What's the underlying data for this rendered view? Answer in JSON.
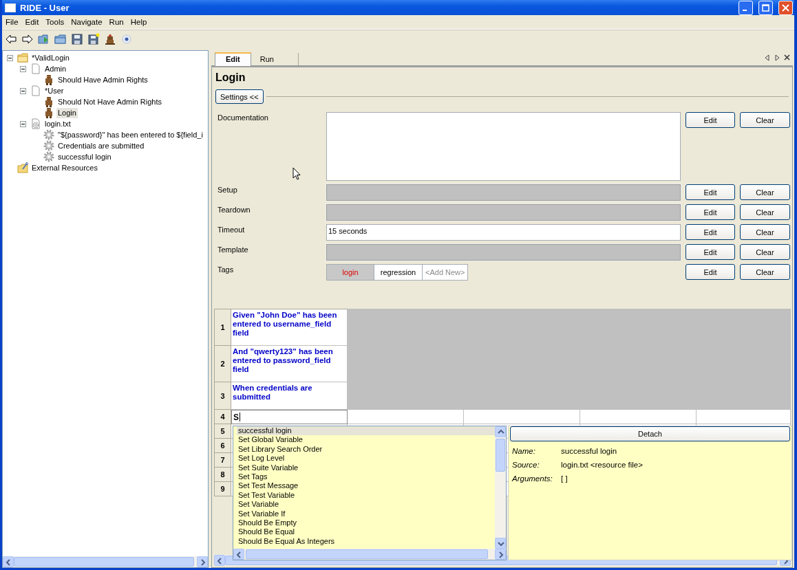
{
  "window": {
    "title": "RIDE - User"
  },
  "menu": [
    "File",
    "Edit",
    "Tools",
    "Navigate",
    "Run",
    "Help"
  ],
  "tree": [
    {
      "label": "*ValidLogin",
      "kind": "suite",
      "expanded": true,
      "selected": false,
      "children": [
        {
          "label": "Admin",
          "kind": "file",
          "expanded": true,
          "selected": false,
          "children": [
            {
              "label": "Should Have Admin Rights",
              "kind": "test",
              "selected": false
            }
          ]
        },
        {
          "label": "*User",
          "kind": "file",
          "expanded": true,
          "selected": false,
          "children": [
            {
              "label": "Should Not Have Admin Rights",
              "kind": "test",
              "selected": false
            },
            {
              "label": "Login",
              "kind": "test",
              "selected": true
            }
          ]
        },
        {
          "label": "login.txt",
          "kind": "resource",
          "expanded": true,
          "selected": false,
          "children": [
            {
              "label": "\"${password}\" has been entered to ${field_i",
              "kind": "keyword",
              "selected": false
            },
            {
              "label": "Credentials are submitted",
              "kind": "keyword",
              "selected": false
            },
            {
              "label": "successful login",
              "kind": "keyword",
              "selected": false
            }
          ]
        }
      ]
    },
    {
      "label": "External Resources",
      "kind": "external",
      "selected": false
    }
  ],
  "tabs": [
    {
      "label": "Edit",
      "selected": true
    },
    {
      "label": "Run",
      "selected": false
    }
  ],
  "editor": {
    "title": "Login",
    "settings_button": "Settings <<",
    "settings": [
      {
        "label": "Documentation",
        "kind": "multiline",
        "disabled": false,
        "edit_button": "Edit",
        "clear_button": "Clear"
      },
      {
        "label": "Setup",
        "kind": "line",
        "disabled": true,
        "edit_button": "Edit",
        "clear_button": "Clear"
      },
      {
        "label": "Teardown",
        "kind": "line",
        "disabled": true,
        "edit_button": "Edit",
        "clear_button": "Clear"
      },
      {
        "label": "Timeout",
        "kind": "line",
        "disabled": false,
        "value": "15 seconds",
        "edit_button": "Edit",
        "clear_button": "Clear"
      },
      {
        "label": "Template",
        "kind": "line",
        "disabled": true,
        "edit_button": "Edit",
        "clear_button": "Clear"
      },
      {
        "label": "Tags",
        "kind": "tags",
        "tags": [
          {
            "label": "login",
            "kind": "forced"
          },
          {
            "label": "regression",
            "kind": "normal"
          },
          {
            "label": "<Add New>",
            "kind": "add"
          }
        ],
        "edit_button": "Edit",
        "clear_button": "Clear"
      }
    ]
  },
  "grid": {
    "rows": [
      {
        "number": "1",
        "kind": "keyword",
        "text": "Given \"John Doe\" has been entered to username_field field"
      },
      {
        "number": "2",
        "kind": "keyword",
        "text": "And \"qwerty123\" has been entered to password_field field"
      },
      {
        "number": "3",
        "kind": "keyword",
        "text": "When credentials are submitted"
      },
      {
        "number": "4",
        "kind": "editing",
        "text": "S"
      },
      {
        "number": "5",
        "kind": "empty"
      },
      {
        "number": "6",
        "kind": "empty"
      },
      {
        "number": "7",
        "kind": "empty"
      },
      {
        "number": "8",
        "kind": "empty"
      },
      {
        "number": "9",
        "kind": "empty"
      }
    ]
  },
  "autocomplete": {
    "items": [
      {
        "label": "successful login",
        "selected": true
      },
      {
        "label": "Set Global Variable",
        "selected": false
      },
      {
        "label": "Set Library Search Order",
        "selected": false
      },
      {
        "label": "Set Log Level",
        "selected": false
      },
      {
        "label": "Set Suite Variable",
        "selected": false
      },
      {
        "label": "Set Tags",
        "selected": false
      },
      {
        "label": "Set Test Message",
        "selected": false
      },
      {
        "label": "Set Test Variable",
        "selected": false
      },
      {
        "label": "Set Variable",
        "selected": false
      },
      {
        "label": "Set Variable If",
        "selected": false
      },
      {
        "label": "Should Be Empty",
        "selected": false
      },
      {
        "label": "Should Be Equal",
        "selected": false
      },
      {
        "label": "Should Be Equal As Integers",
        "selected": false
      }
    ]
  },
  "details": {
    "button": "Detach",
    "fields": [
      {
        "label": "Name:",
        "value": "successful login"
      },
      {
        "label": "Source:",
        "value": "login.txt <resource file>"
      },
      {
        "label": "Arguments:",
        "value": "[ ]"
      }
    ]
  }
}
